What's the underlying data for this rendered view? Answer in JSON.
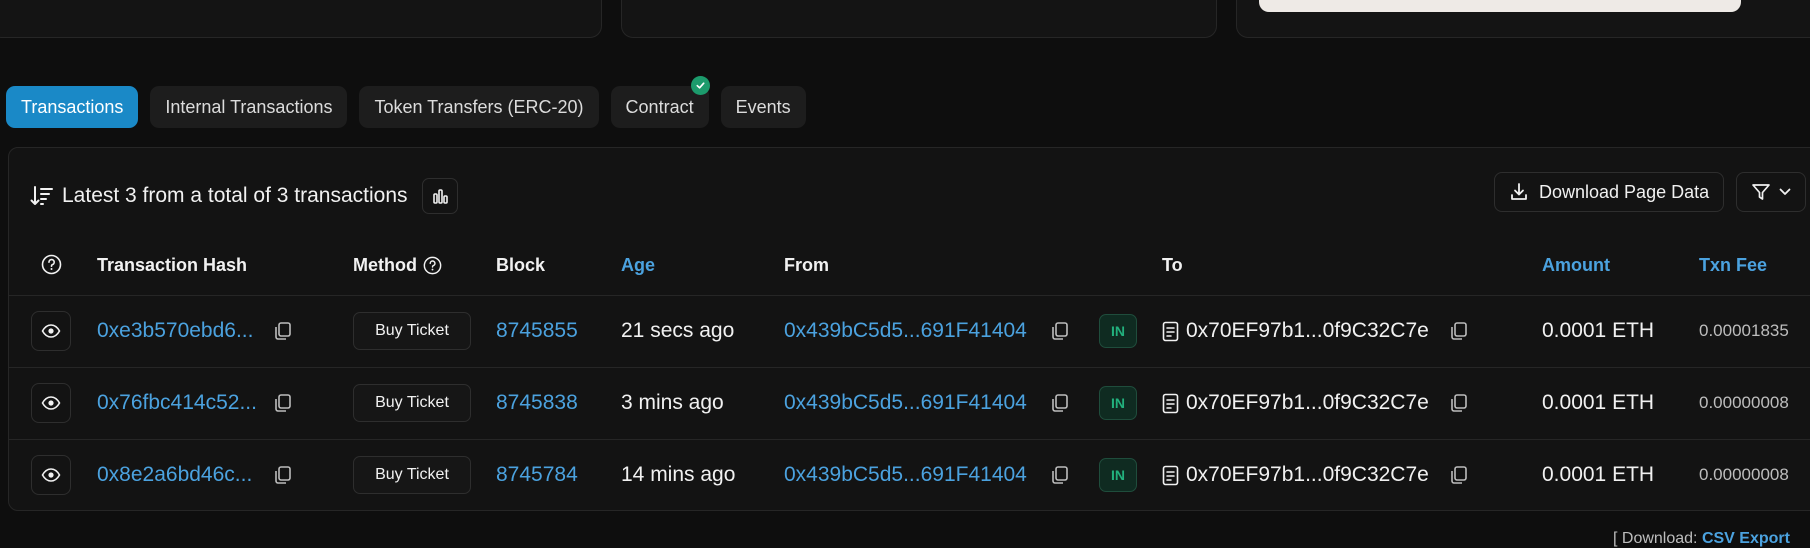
{
  "tabs": [
    {
      "label": "Transactions",
      "active": true
    },
    {
      "label": "Internal Transactions"
    },
    {
      "label": "Token Transfers (ERC-20)"
    },
    {
      "label": "Contract",
      "verified": true
    },
    {
      "label": "Events"
    }
  ],
  "summary": {
    "text": "Latest 3 from a total of 3 transactions"
  },
  "toolbar": {
    "download_label": "Download Page Data"
  },
  "table": {
    "headers": {
      "hash": "Transaction Hash",
      "method": "Method",
      "block": "Block",
      "age": "Age",
      "from": "From",
      "to": "To",
      "amount": "Amount",
      "fee": "Txn Fee"
    },
    "rows": [
      {
        "hash": "0xe3b570ebd6...",
        "method": "Buy Ticket",
        "block": "8745855",
        "age": "21 secs ago",
        "from": "0x439bC5d5...691F41404",
        "direction": "IN",
        "to": "0x70EF97b1...0f9C32C7e",
        "amount": "0.0001 ETH",
        "fee": "0.00001835"
      },
      {
        "hash": "0x76fbc414c52...",
        "method": "Buy Ticket",
        "block": "8745838",
        "age": "3 mins ago",
        "from": "0x439bC5d5...691F41404",
        "direction": "IN",
        "to": "0x70EF97b1...0f9C32C7e",
        "amount": "0.0001 ETH",
        "fee": "0.00000008"
      },
      {
        "hash": "0x8e2a6bd46c...",
        "method": "Buy Ticket",
        "block": "8745784",
        "age": "14 mins ago",
        "from": "0x439bC5d5...691F41404",
        "direction": "IN",
        "to": "0x70EF97b1...0f9C32C7e",
        "amount": "0.0001 ETH",
        "fee": "0.00000008"
      }
    ]
  },
  "footer": {
    "prefix": "[ Download:",
    "link": "CSV Export"
  },
  "colors": {
    "accent": "#1a89c7",
    "link": "#4ba2df",
    "in_badge": "#22b07d",
    "background": "#0e0e0e"
  },
  "icons": [
    "sort-desc-icon",
    "bar-chart-icon",
    "download-icon",
    "filter-icon",
    "chevron-down-icon",
    "help-circle-icon",
    "eye-icon",
    "copy-icon",
    "contract-doc-icon",
    "check-icon"
  ]
}
